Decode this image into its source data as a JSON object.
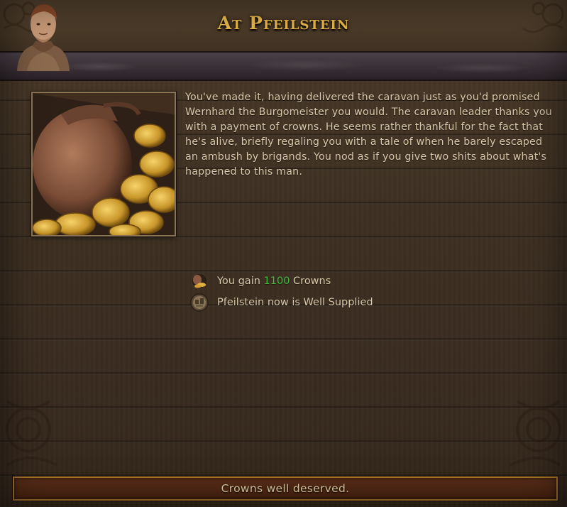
{
  "event": {
    "title": "At Pfeilstein",
    "body": "You've made it, having delivered the caravan just as you'd promised Wernhard the Burgomeister you would. The caravan leader thanks you with a payment of crowns. He seems rather thankful for the fact that he's alive, briefly regaling you with a tale of when he barely escaped an ambush by brigands. You nod as if you give two shits about what's happened to this man."
  },
  "results": [
    {
      "icon": "money-bag-icon",
      "prefix": "You gain ",
      "value": "1100",
      "suffix": " Crowns"
    },
    {
      "icon": "settlement-supply-icon",
      "text": "Pfeilstein now is Well Supplied"
    }
  ],
  "options": [
    {
      "label": "Crowns well deserved."
    }
  ],
  "colors": {
    "title": "#e8b84a",
    "body_text": "#d8c8aa",
    "positive_value": "#3fbf3f",
    "button_border": "#a8742c"
  }
}
